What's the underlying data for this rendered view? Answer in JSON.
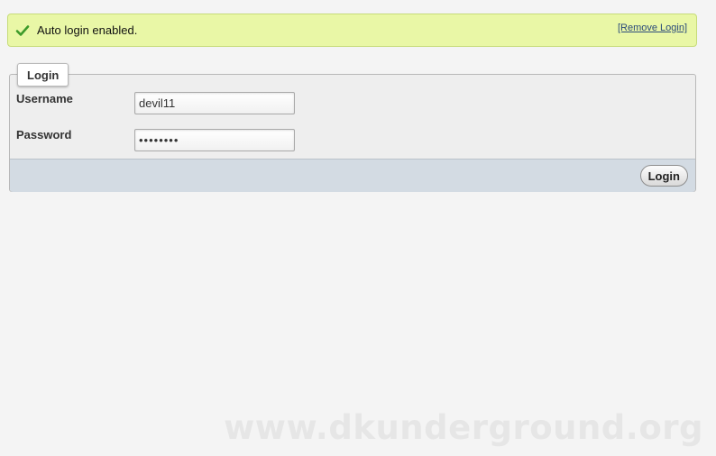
{
  "notice": {
    "message": "Auto login enabled.",
    "remove_link": "[Remove Login]",
    "icon": "check-icon",
    "color": "#e9f7a6"
  },
  "login_form": {
    "legend": "Login",
    "username_label": "Username",
    "username_value": "devil11",
    "password_label": "Password",
    "password_value": "••••••••",
    "submit_label": "Login"
  },
  "watermark": "www.dkunderground.org"
}
